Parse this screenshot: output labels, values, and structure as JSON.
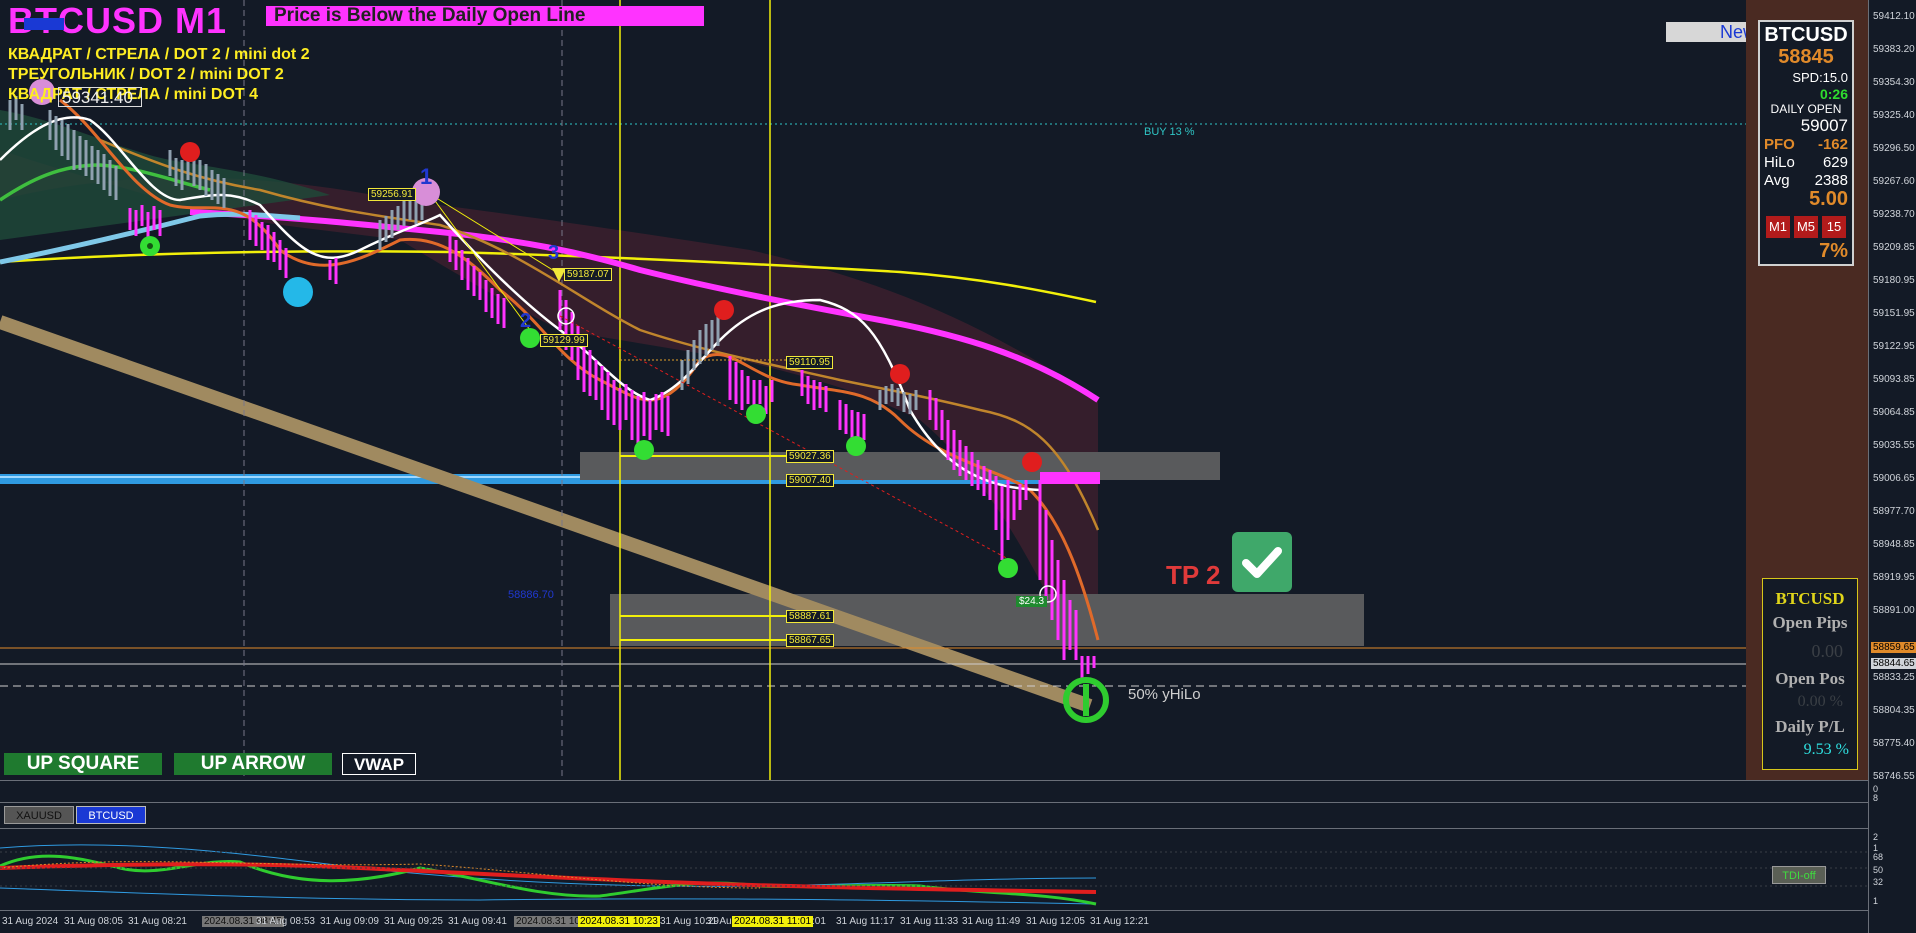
{
  "chart": {
    "symbol_title": "BTCUSD M1",
    "status_banner": "Price is Below the Daily Open Line",
    "notes": [
      "КВАДРАТ / СТРЕЛА / DOT 2 / mini dot 2",
      "ТРЕУГОЛЬНИК / DOT 2 / mini DOT 2",
      "КВАДРАТ / СТРЕЛА /  mini DOT 4"
    ],
    "price_tag": "59341.40",
    "new_button": "New",
    "buy_text": "BUY 13 %",
    "tp_label": "TP 2",
    "yhilo_label": "50% yHiLo",
    "profit_tag": "$24.3",
    "price_labels": [
      "59256.91",
      "59187.07",
      "59129.99",
      "59110.95",
      "59027.36",
      "59007.40",
      "58887.61",
      "58867.65"
    ],
    "wave_numbers": [
      "1",
      "3",
      "2"
    ]
  },
  "info_panel": {
    "symbol": "BTCUSD",
    "price": "58845",
    "spread": "SPD:15.0",
    "timer": "0:26",
    "daily_open_label": "DAILY OPEN",
    "daily_open": "59007",
    "pfo_label": "PFO",
    "pfo": "-162",
    "hilo_label": "HiLo",
    "hilo": "629",
    "avg_label": "Avg",
    "avg": "2388",
    "ratio": "5.00",
    "timeframes": [
      "M1",
      "M5",
      "15"
    ],
    "percent": "7%"
  },
  "position_panel": {
    "symbol": "BTCUSD",
    "open_pips_label": "Open Pips",
    "open_pips": "0.00",
    "open_pos_label": "Open Pos",
    "open_pos": "0.00 %",
    "daily_pl_label": "Daily P/L",
    "daily_pl": "9.53 %"
  },
  "bottom_buttons": {
    "up_square": "UP SQUARE",
    "up_arrow": "UP ARROW",
    "vwap": "VWAP"
  },
  "symbol_tabs": [
    "XAUUSD",
    "BTCUSD"
  ],
  "tdi_button": "TDI-off",
  "price_axis": [
    "59412.10",
    "59383.20",
    "59354.30",
    "59325.40",
    "59296.50",
    "59267.60",
    "59238.70",
    "59209.85",
    "59180.95",
    "59151.95",
    "59122.95",
    "59093.85",
    "59064.85",
    "59035.55",
    "59006.65",
    "58977.70",
    "58948.85",
    "58919.95",
    "58891.00",
    "58859.65",
    "58844.65",
    "58833.25",
    "58804.35",
    "58775.40",
    "58746.55"
  ],
  "sub_axis_top": [
    "0",
    "8"
  ],
  "sub_axis_bottom": [
    "2",
    "1",
    "68",
    "50",
    "32",
    "1"
  ],
  "time_axis": [
    "31 Aug 2024",
    "31 Aug 08:05",
    "31 Aug 08:21",
    "2024.08.31 08:45",
    "31 Aug 08:53",
    "31 Aug 09:09",
    "31 Aug 09:25",
    "31 Aug 09:41",
    "2024.08.31 10:",
    "2024.08.31 10:23",
    "31 Aug 10:29",
    "31 Au",
    "2024.08.31 11:01",
    ":01",
    "31 Aug 11:17",
    "31 Aug 11:33",
    "31 Aug 11:49",
    "31 Aug 12:05",
    "31 Aug 12:21"
  ],
  "colors": {
    "background": "#131a26",
    "magenta": "#ff33ff",
    "yellow": "#f2f00a",
    "daily_open_blue": "#2f9ae0",
    "orange": "#e08a2a",
    "sell_red": "#e01e1e",
    "buy_green": "#22cc22"
  }
}
